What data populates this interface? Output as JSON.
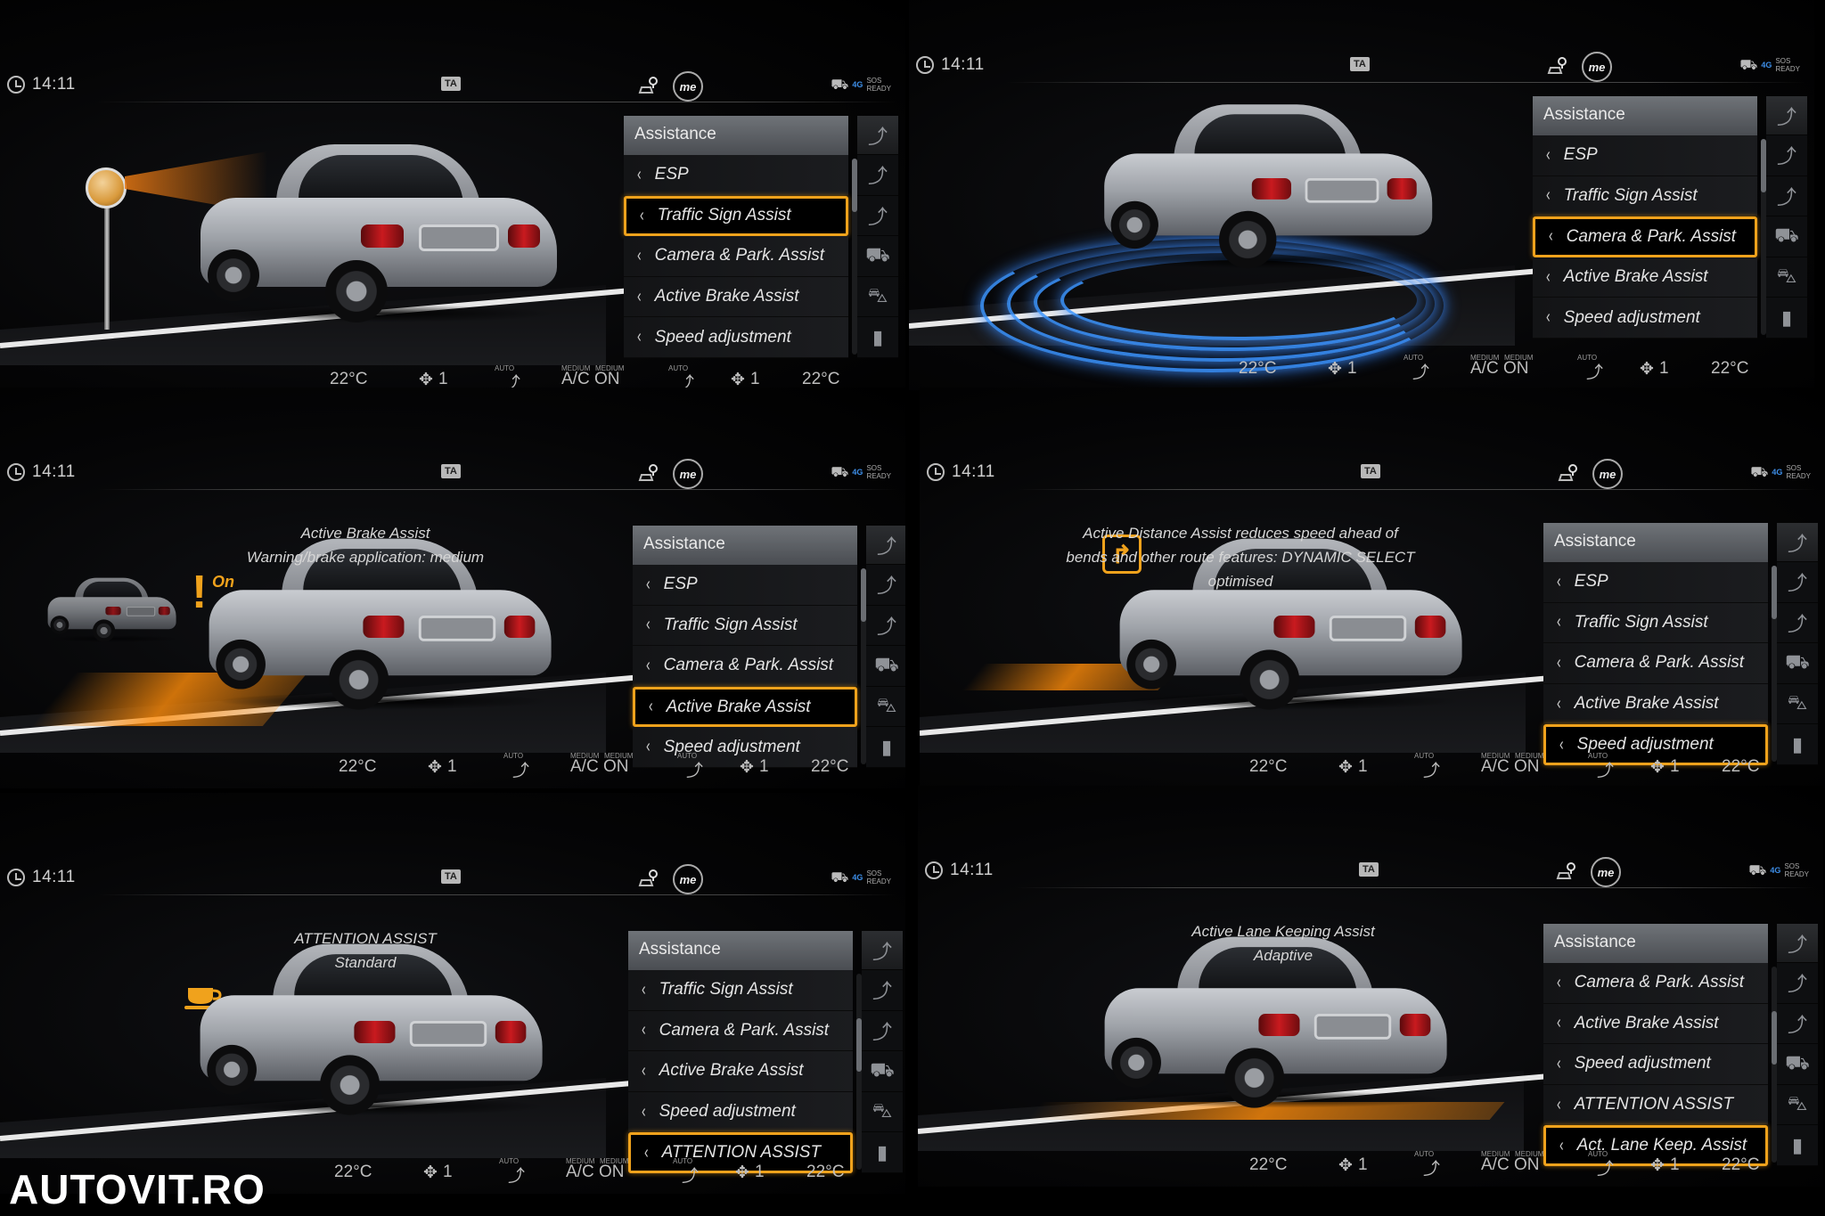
{
  "common": {
    "time": "14:11",
    "ta": "TA",
    "me": "me",
    "lte": "4G",
    "sos": "SOS",
    "ready": "READY",
    "menu_title": "Assistance",
    "climate": {
      "temp_left": "22°C",
      "fan_left": "1",
      "auto": "AUTO",
      "medium": "MEDIUM",
      "ac": "A/C ON",
      "fan_right": "1",
      "temp_right": "22°C"
    },
    "accent_color": "#f0a21c"
  },
  "panels": [
    {
      "menu": [
        "ESP",
        "Traffic Sign Assist",
        "Camera & Park. Assist",
        "Active Brake Assist",
        "Speed adjustment"
      ],
      "active": "Traffic Sign Assist",
      "info": []
    },
    {
      "menu": [
        "ESP",
        "Traffic Sign Assist",
        "Camera & Park. Assist",
        "Active Brake Assist",
        "Speed adjustment"
      ],
      "active": "Camera & Park. Assist",
      "info": []
    },
    {
      "menu": [
        "ESP",
        "Traffic Sign Assist",
        "Camera & Park. Assist",
        "Active Brake Assist",
        "Speed adjustment"
      ],
      "active": "Active Brake Assist",
      "info": [
        "Active Brake Assist",
        "Warning/brake application: medium"
      ],
      "on_label": "On"
    },
    {
      "menu": [
        "ESP",
        "Traffic Sign Assist",
        "Camera & Park. Assist",
        "Active Brake Assist",
        "Speed adjustment"
      ],
      "active": "Speed adjustment",
      "info": [
        "Active Distance Assist reduces speed ahead of",
        "bends and other route features: DYNAMIC SELECT optimised"
      ]
    },
    {
      "menu": [
        "Traffic Sign Assist",
        "Camera & Park. Assist",
        "Active Brake Assist",
        "Speed adjustment",
        "ATTENTION ASSIST"
      ],
      "active": "ATTENTION ASSIST",
      "info": [
        "ATTENTION ASSIST",
        "Standard"
      ]
    },
    {
      "menu": [
        "Camera & Park. Assist",
        "Active Brake Assist",
        "Speed adjustment",
        "ATTENTION ASSIST",
        "Act. Lane Keep. Assist"
      ],
      "active": "Act. Lane Keep. Assist",
      "info": [
        "Active Lane Keeping Assist",
        "Adaptive"
      ]
    }
  ],
  "watermark": "AUTOVIT.RO"
}
